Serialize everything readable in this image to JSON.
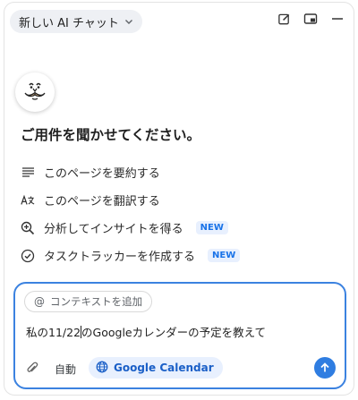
{
  "header": {
    "chat_selector_label": "新しい AI チャット",
    "icons": [
      "edit-icon",
      "picture-in-picture-icon",
      "minimize-icon"
    ]
  },
  "assistant": {
    "avatar_icon": "mustache-face-icon",
    "heading": "ご用件を聞かせてください。"
  },
  "actions": [
    {
      "icon": "summary-lines-icon",
      "label": "このページを要約する",
      "badge": ""
    },
    {
      "icon": "translate-icon",
      "label": "このページを翻訳する",
      "badge": ""
    },
    {
      "icon": "zoom-insight-icon",
      "label": "分析してインサイトを得る",
      "badge": "NEW"
    },
    {
      "icon": "check-circle-icon",
      "label": "タスクトラッカーを作成する",
      "badge": "NEW"
    }
  ],
  "composer": {
    "context_chip_label": "コンテキストを追加",
    "input_text_before_caret": "私の11/22",
    "input_text_after_caret": "のGoogleカレンダーの予定を教えて",
    "mode_label": "自動",
    "tool_chip_label": "Google Calendar"
  },
  "colors": {
    "accent": "#2f7de1",
    "badge_bg": "#e8f0fe",
    "badge_text": "#1a73e8",
    "chip_bg": "#eef0f4"
  }
}
